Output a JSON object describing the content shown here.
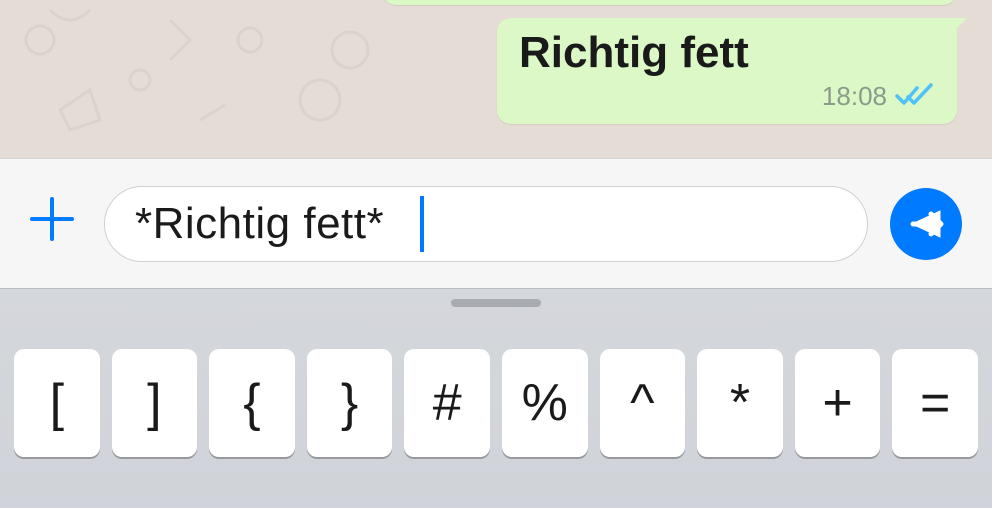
{
  "chat": {
    "message": {
      "text": "Richtig fett",
      "time": "18:08",
      "read": true
    }
  },
  "input": {
    "value": "*Richtig fett*",
    "plus_icon": "plus",
    "send_icon": "send"
  },
  "keyboard": {
    "handle": "keyboard-handle",
    "keys": [
      "[",
      "]",
      "{",
      "}",
      "#",
      "%",
      "^",
      "*",
      "+",
      "="
    ]
  },
  "colors": {
    "accent": "#007aff",
    "bubble": "#dcf8c6",
    "read_tick": "#4fc3f7"
  }
}
